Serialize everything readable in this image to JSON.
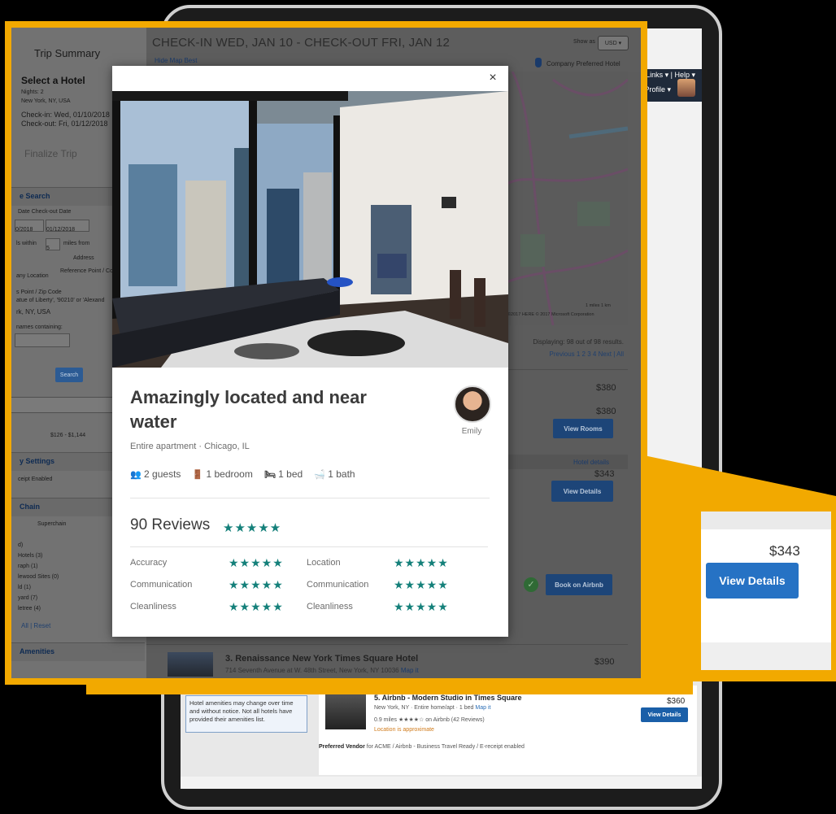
{
  "tablet": {
    "top_links": "Links ▾  |  Help ▾",
    "profile": "Profile ▾",
    "amenities_note": "Hotel amenities may change over time and without notice. Not all hotels have provided their amenities list.",
    "listing5": {
      "title": "5. Airbnb - Modern Studio in Times Square",
      "sub": "New York, NY · Entire home/apt · 1 bed",
      "map_link": "Map it",
      "rating": "0.9 miles  ★★★★☆  on Airbnb (42 Reviews)",
      "approx": "Location is approximate",
      "price": "$360",
      "button": "View Details",
      "preferred_label": "Preferred Vendor",
      "preferred_text": " for ACME / Airbnb - Business Travel Ready / E-receipt enabled"
    }
  },
  "sidebar": {
    "title": "Trip Summary",
    "select_hotel": "Select a Hotel",
    "nights": "Nights: 2",
    "location": "New York, NY, USA",
    "check_in": "Check-in: Wed, 01/10/2018",
    "check_out": "Check-out: Fri, 01/12/2018",
    "finalize": "Finalize Trip",
    "search_section": "e Search",
    "date_labels": "Date   Check-out Date",
    "date_from": "0/2018",
    "date_to": "01/12/2018",
    "within_prefix": "ls within",
    "within_value": "5",
    "within_suffix": "miles from",
    "address_label": "Address",
    "company_location": "any Location",
    "ref_point": "Reference Point / Code",
    "ref_point_label": "s Point / Zip Code",
    "ref_point_hint": "atue of Liberty', '90210' or 'Alexand",
    "ref_point_value": "rk, NY, USA",
    "names_containing": "names containing:",
    "search_button": "Search",
    "price_range": "$126 - $1,144",
    "settings_section": "y Settings",
    "settings_item": "ceipt Enabled",
    "chain_section": "Chain",
    "superchain": "Superchain",
    "chain_items": [
      "d)",
      "Hotels (3)",
      "raph (1)",
      "lewood Sites (0)",
      "ld (1)",
      "yard (7)",
      "letree (4)"
    ],
    "all_reset": "All  |  Reset",
    "amenities_section": "Amenities"
  },
  "main": {
    "check_dates": "CHECK-IN WED, JAN 10 - CHECK-OUT FRI, JAN 12",
    "show_as": "Show as",
    "currency": "USD ▾",
    "map_links": "Hide Map   Best",
    "preferred_hotel": "Company Preferred Hotel",
    "map_copyright": "©2017 HERE  © 2017 Microsoft Corporation",
    "map_scale": "1 miles    1 km",
    "displaying": "Displaying: 98 out of 98 results.",
    "pagination": "Previous 1 2 3 4  Next  |  All",
    "prices": [
      "$380",
      "$380",
      "$343"
    ],
    "view_rooms": "View Rooms",
    "hotel_details": "Hotel details",
    "view_details": "View Details",
    "book_airbnb": "Book on Airbnb",
    "listing3_title": "3. Renaissance New York Times Square Hotel",
    "listing3_sub": "714 Seventh Avenue at W. 48th Street, New York, NY 10036",
    "listing3_map": "Map it",
    "listing3_price": "$390"
  },
  "modal": {
    "close": "×",
    "title": "Amazingly located and near water",
    "host": "Emily",
    "subtitle": "Entire apartment · Chicago, IL",
    "amenities": [
      {
        "icon": "guests-icon",
        "glyph": "👥",
        "text": "2 guests"
      },
      {
        "icon": "bedroom-icon",
        "glyph": "🚪",
        "text": "1 bedroom"
      },
      {
        "icon": "bed-icon",
        "glyph": "🛏",
        "text": "1 bed"
      },
      {
        "icon": "bath-icon",
        "glyph": "🛁",
        "text": "1 bath"
      }
    ],
    "reviews_label": "90 Reviews",
    "stars": "★★★★★",
    "ratings": [
      {
        "left": "Accuracy",
        "right": "Location"
      },
      {
        "left": "Communication",
        "right": "Communication"
      },
      {
        "left": "Cleanliness",
        "right": "Cleanliness"
      }
    ]
  },
  "zoom": {
    "price": "$343",
    "button": "View Details"
  },
  "colors": {
    "accent_yellow": "#f2a900",
    "button_blue": "#2672c4",
    "star_teal": "#14807a"
  }
}
